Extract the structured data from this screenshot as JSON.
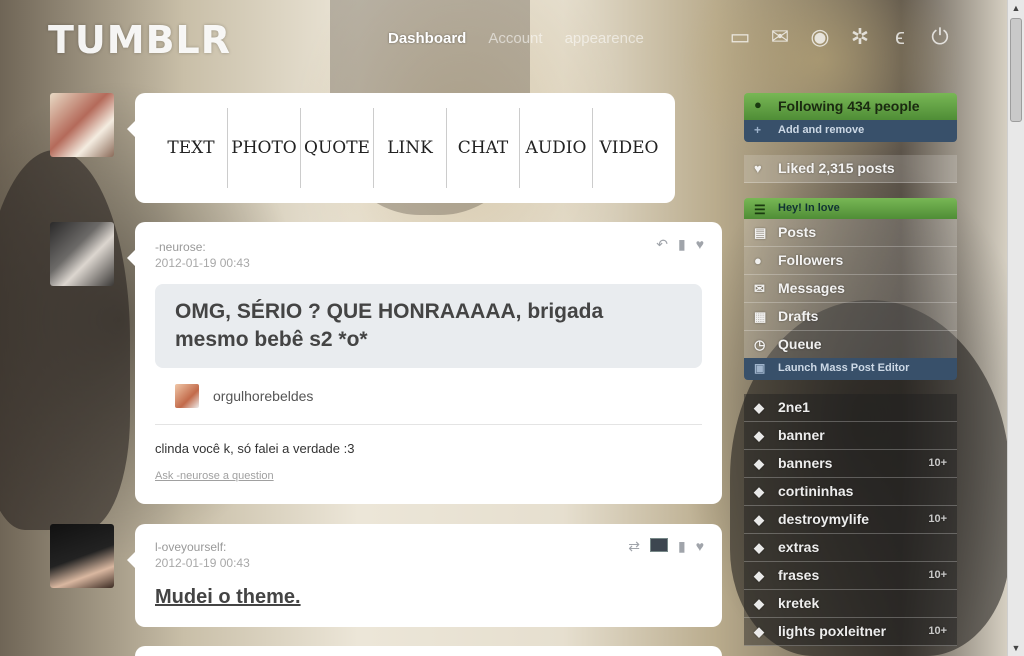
{
  "header": {
    "logo": "TUMBLR",
    "nav": [
      {
        "label": "Dashboard",
        "active": true
      },
      {
        "label": "Account",
        "active": false
      },
      {
        "label": "appearence",
        "active": false
      }
    ],
    "icons": [
      "inbox-icon",
      "mail-icon",
      "search-icon",
      "gear-icon",
      "tumblr-t-icon",
      "power-icon"
    ]
  },
  "post_types": [
    "TEXT",
    "PHOTO",
    "QUOTE",
    "LINK",
    "CHAT",
    "AUDIO",
    "VIDEO"
  ],
  "posts": [
    {
      "author": "-neurose:",
      "date": "2012-01-19 00:43",
      "question": "OMG, SÉRIO ? QUE HONRAAAAA, brigada mesmo bebê s2 *o*",
      "asker": "orgulhorebeldes",
      "answer": "clinda você k, só falei a verdade :3",
      "ask_link": "Ask -neurose a question",
      "controls": [
        "reply-icon",
        "bookmark-icon",
        "heart-icon"
      ]
    },
    {
      "author": "l-oveyourself:",
      "date": "2012-01-19 00:43",
      "title": "Mudei o theme.",
      "controls": [
        "reblog-icon",
        "photo-icon",
        "bookmark-icon",
        "heart-icon"
      ]
    }
  ],
  "sidebar": {
    "following": "Following 434 people",
    "add_remove": "Add and remove",
    "liked": "Liked 2,315 posts",
    "blog_name": "Hey! In love",
    "blog_links": [
      "Posts",
      "Followers",
      "Messages",
      "Drafts",
      "Queue"
    ],
    "launch": "Launch Mass Post Editor",
    "tags": [
      {
        "name": "2ne1",
        "count": ""
      },
      {
        "name": "banner",
        "count": ""
      },
      {
        "name": "banners",
        "count": "10+"
      },
      {
        "name": "cortininhas",
        "count": ""
      },
      {
        "name": "destroymylife",
        "count": "10+"
      },
      {
        "name": "extras",
        "count": ""
      },
      {
        "name": "frases",
        "count": "10+"
      },
      {
        "name": "kretek",
        "count": ""
      },
      {
        "name": "lights poxleitner",
        "count": "10+"
      }
    ]
  },
  "colors": {
    "accent_green": "#5f9e43",
    "accent_blue": "#38506a",
    "card_bg": "#ffffff",
    "quote_bg": "#e9ecef"
  }
}
